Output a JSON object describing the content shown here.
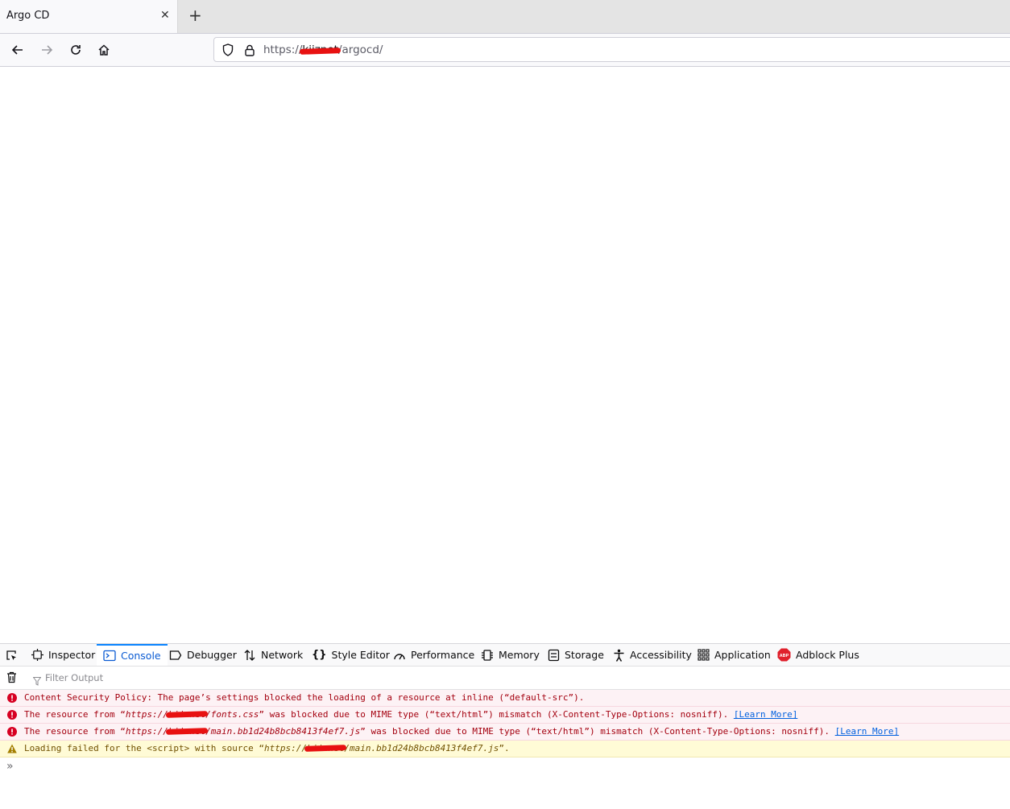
{
  "tab": {
    "title": "Argo CD",
    "close_glyph": "✕",
    "new_tab_glyph": "+"
  },
  "nav": {
    "url_prefix": "https://",
    "url_host_redacted": "kiiznet",
    "url_path": "/argocd/"
  },
  "devtools": {
    "tabs": [
      {
        "label": "Inspector",
        "icon": "inspector-icon"
      },
      {
        "label": "Console",
        "icon": "console-icon",
        "active": true
      },
      {
        "label": "Debugger",
        "icon": "debugger-icon"
      },
      {
        "label": "Network",
        "icon": "network-icon"
      },
      {
        "label": "Style Editor",
        "icon": "style-editor-icon"
      },
      {
        "label": "Performance",
        "icon": "performance-icon"
      },
      {
        "label": "Memory",
        "icon": "memory-icon"
      },
      {
        "label": "Storage",
        "icon": "storage-icon"
      },
      {
        "label": "Accessibility",
        "icon": "accessibility-icon"
      },
      {
        "label": "Application",
        "icon": "application-icon"
      },
      {
        "label": "Adblock Plus",
        "icon": "adblock-plus-icon"
      }
    ],
    "filter_placeholder": "Filter Output",
    "messages": [
      {
        "level": "error",
        "text": "Content Security Policy: The page’s settings blocked the loading of a resource at inline (“default-src”)."
      },
      {
        "level": "error",
        "pre": "The resource from “",
        "url_a": "https://",
        "url_redacted": "kiiznet",
        "url_b": "/fonts.css",
        "post": "” was blocked due to MIME type (“text/html”) mismatch (X-Content-Type-Options: nosniff). ",
        "link": "[Learn More]"
      },
      {
        "level": "error",
        "pre": "The resource from “",
        "url_a": "https://",
        "url_redacted": "kiiznet",
        "url_b": "/main.bb1d24b8bcb8413f4ef7.js",
        "post": "” was blocked due to MIME type (“text/html”) mismatch (X-Content-Type-Options: nosniff). ",
        "link": "[Learn More]"
      },
      {
        "level": "warning",
        "pre": "Loading failed for the <script> with source “",
        "url_a": "https://",
        "url_redacted": "kiiznet",
        "url_b": "/main.bb1d24b8bcb8413f4ef7.js",
        "post": "”."
      }
    ],
    "prompt_glyph": "»"
  },
  "colors": {
    "error": "#a4000f",
    "warning": "#715100",
    "accent": "#0a84ff"
  }
}
